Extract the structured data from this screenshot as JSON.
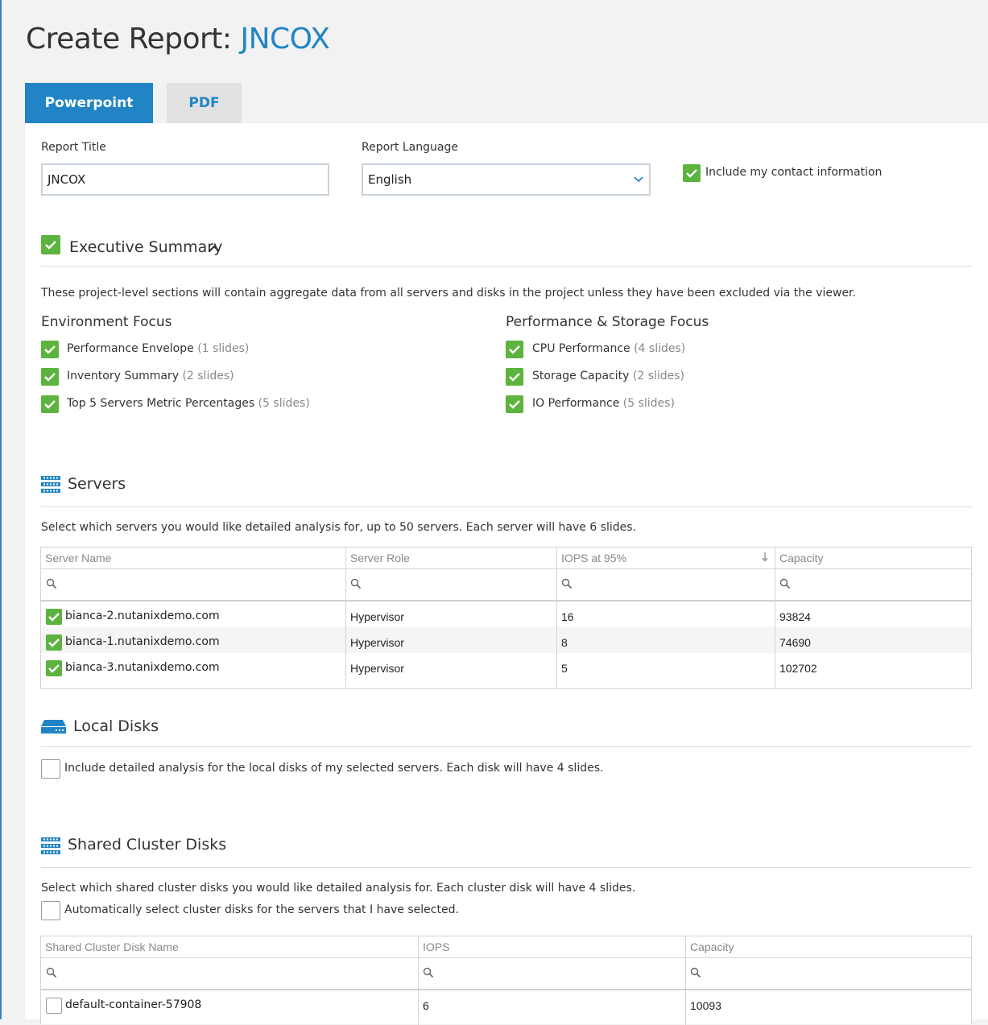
{
  "header": {
    "title_prefix": "Create Report:",
    "project_name": "JNCOX"
  },
  "tabs": [
    {
      "label": "Powerpoint",
      "active": true
    },
    {
      "label": "PDF",
      "active": false
    }
  ],
  "form": {
    "report_title_label": "Report Title",
    "report_title_value": "JNCOX",
    "report_language_label": "Report Language",
    "report_language_value": "English",
    "contact_label": "Include my contact information",
    "contact_checked": true
  },
  "executive_summary": {
    "title": "Executive Summary",
    "checked": true,
    "description": "These project-level sections will contain aggregate data from all servers and disks in the project unless they have been excluded via the viewer.",
    "environment": {
      "title": "Environment Focus",
      "items": [
        {
          "label": "Performance Envelope",
          "slides": "(1 slides)",
          "checked": true
        },
        {
          "label": "Inventory Summary",
          "slides": "(2 slides)",
          "checked": true
        },
        {
          "label": "Top 5 Servers Metric Percentages",
          "slides": "(5 slides)",
          "checked": true
        }
      ]
    },
    "performance": {
      "title": "Performance & Storage Focus",
      "items": [
        {
          "label": "CPU Performance",
          "slides": "(4 slides)",
          "checked": true
        },
        {
          "label": "Storage Capacity",
          "slides": "(2 slides)",
          "checked": true
        },
        {
          "label": "IO Performance",
          "slides": "(5 slides)",
          "checked": true
        }
      ]
    }
  },
  "servers": {
    "title": "Servers",
    "description": "Select which servers you would like detailed analysis for, up to 50 servers. Each server will have 6 slides.",
    "columns": [
      "Server Name",
      "Server Role",
      "IOPS at 95%",
      "Capacity"
    ],
    "sorted_column": "IOPS at 95%",
    "rows": [
      {
        "name": "bianca-2.nutanixdemo.com",
        "role": "Hypervisor",
        "iops": "16",
        "capacity": "93824",
        "checked": true
      },
      {
        "name": "bianca-1.nutanixdemo.com",
        "role": "Hypervisor",
        "iops": "8",
        "capacity": "74690",
        "checked": true
      },
      {
        "name": "bianca-3.nutanixdemo.com",
        "role": "Hypervisor",
        "iops": "5",
        "capacity": "102702",
        "checked": true
      }
    ]
  },
  "local_disks": {
    "title": "Local Disks",
    "option_label": "Include detailed analysis for the local disks of my selected servers. Each disk will have 4 slides.",
    "checked": false
  },
  "shared_disks": {
    "title": "Shared Cluster Disks",
    "description": "Select which shared cluster disks you would like detailed analysis for. Each cluster disk will have 4 slides.",
    "auto_select_label": "Automatically select cluster disks for the servers that I have selected.",
    "auto_select_checked": false,
    "columns": [
      "Shared Cluster Disk Name",
      "IOPS",
      "Capacity"
    ],
    "rows": [
      {
        "name": "default-container-57908",
        "iops": "6",
        "capacity": "10093",
        "checked": false
      }
    ]
  },
  "colors": {
    "accent": "#2185c5",
    "check_green": "#5cb33e",
    "tab_inactive": "#e1e1e1"
  }
}
